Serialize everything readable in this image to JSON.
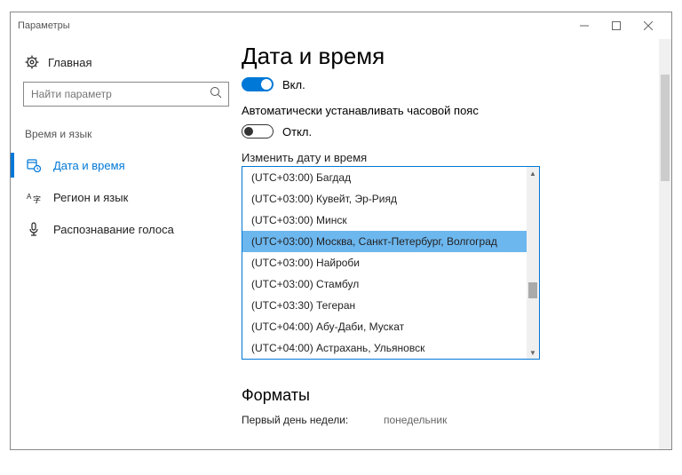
{
  "window": {
    "title": "Параметры"
  },
  "sidebar": {
    "home_label": "Главная",
    "search_placeholder": "Найти параметр",
    "section_label": "Время и язык",
    "items": [
      {
        "label": "Дата и время"
      },
      {
        "label": "Регион и язык"
      },
      {
        "label": "Распознавание голоса"
      }
    ]
  },
  "page": {
    "heading": "Дата и время",
    "auto_time_on": "Вкл.",
    "auto_tz_label": "Автоматически устанавливать часовой пояс",
    "auto_tz_off": "Откл.",
    "change_dt_label": "Изменить дату и время",
    "timezone_options": [
      "(UTC+03:00) Багдад",
      "(UTC+03:00) Кувейт, Эр-Рияд",
      "(UTC+03:00) Минск",
      "(UTC+03:00) Москва, Санкт-Петербург, Волгоград",
      "(UTC+03:00) Найроби",
      "(UTC+03:00) Стамбул",
      "(UTC+03:30) Тегеран",
      "(UTC+04:00) Абу-Даби, Мускат",
      "(UTC+04:00) Астрахань, Ульяновск"
    ],
    "timezone_selected_index": 3,
    "formats_heading": "Форматы",
    "first_day_label": "Первый день недели:",
    "first_day_value": "понедельник"
  }
}
